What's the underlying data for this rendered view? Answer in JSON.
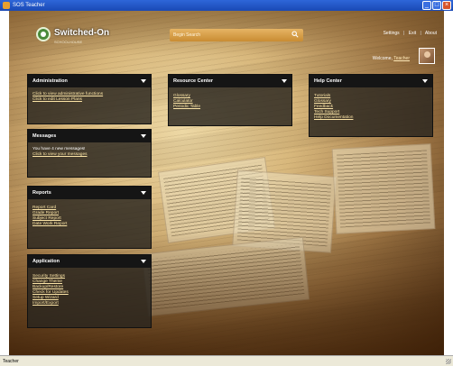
{
  "window": {
    "title": "SOS Teacher",
    "status_text": "Teacher"
  },
  "header": {
    "brand_name": "Switched-On",
    "brand_sub": "SCHOOLHOUSE",
    "search_placeholder": "Begin Search",
    "links": [
      "Settings",
      "Exit",
      "About"
    ],
    "link_separator": "|",
    "welcome_prefix": "Welcome,",
    "user_name": "Teacher"
  },
  "panels": {
    "administration": {
      "title": "Administration",
      "links": [
        "Click to view administrative functions",
        "Click to edit Lesson Plans"
      ]
    },
    "messages": {
      "title": "Messages",
      "text": "You have 4 new messages!",
      "links": [
        "Click to view your messages"
      ]
    },
    "reports": {
      "title": "Reports",
      "links": [
        "Report Card",
        "Grade Report",
        "Subject Report",
        "Date Work Report"
      ]
    },
    "application": {
      "title": "Application",
      "links": [
        "Security Settings",
        "Change Theme",
        "Backup/Restore",
        "Check for Updates",
        "Setup Wizard",
        "Import/Export"
      ]
    },
    "resource_center": {
      "title": "Resource Center",
      "links": [
        "Glossary",
        "Calculator",
        "Periodic Table"
      ]
    },
    "help_center": {
      "title": "Help Center",
      "links": [
        "Tutorials",
        "Glossary",
        "Feedback",
        "Tech Support",
        "Help Documentation"
      ]
    }
  }
}
